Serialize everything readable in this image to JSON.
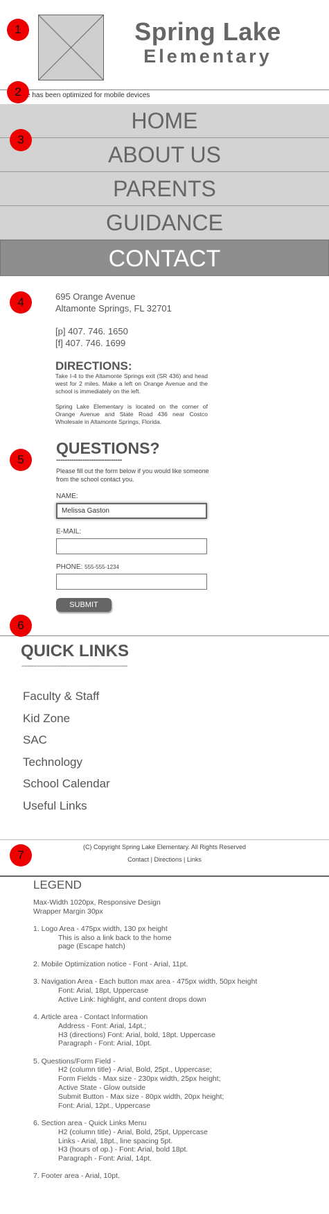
{
  "header": {
    "school_line1": "Spring Lake",
    "school_line2": "Elementary",
    "mobile_notice": "site has been optimized for mobile devices"
  },
  "markers": [
    "1",
    "2",
    "3",
    "4",
    "5",
    "6",
    "7"
  ],
  "nav": {
    "items": [
      {
        "label": "HOME"
      },
      {
        "label": "ABOUT US"
      },
      {
        "label": "PARENTS"
      },
      {
        "label": "GUIDANCE"
      },
      {
        "label": "CONTACT"
      }
    ]
  },
  "contact": {
    "address1": "695 Orange Avenue",
    "address2": "Altamonte Springs, FL 32701",
    "phone": "[p] 407. 746. 1650",
    "fax": "[f] 407. 746. 1699",
    "directions_title": "DIRECTIONS:",
    "directions_p1": "Take I-4 to the Altamonte Springs exit (SR 436) and head west for 2 miles. Make a left on Orange Avenue and the school is immediately on the left.",
    "directions_p2": "Spring Lake Elementary is located on the corner of Orange Avenue and State Road 436 near Costco Wholesale in Altamonte Springs, Florida."
  },
  "questions": {
    "title": "QUESTIONS?",
    "dash": "------------------------------",
    "intro": "Please fill out the form below if you would like someone from the school contact you.",
    "name_label": "NAME:",
    "name_value": "Melissa Gaston",
    "email_label": "E-MAIL:",
    "phone_label": "PHONE:",
    "phone_hint": "555-555-1234",
    "submit_label": "SUBMIT"
  },
  "quick_links": {
    "title": "QUICK LINKS",
    "dash": "------------------------------------------------------",
    "items": [
      "Faculty & Staff",
      "Kid Zone",
      "SAC",
      "Technology",
      "School Calendar",
      "Useful Links"
    ]
  },
  "footer": {
    "copyright": "(C) Copyright Spring Lake Elementary. All Rights Reserved",
    "link_contact": "Contact",
    "link_directions": "Directions",
    "link_links": "Links",
    "separator": "|"
  },
  "legend": {
    "title": "LEGEND",
    "intro1": "Max-Width 1020px, Responsive Design",
    "intro2": "Wrapper Margin 30px",
    "i1_a": "1. Logo Area - 475px width, 130 px height",
    "i1_b": "This is also a link back to the home",
    "i1_c": "page (Escape hatch)",
    "i2_a": "2. Mobile Optimization notice - Font - Arial, 11pt.",
    "i3_a": "3. Navigation Area - Each button max area - 475px width, 50px height",
    "i3_b": "Font: Arial, 18pt, Uppercase",
    "i3_c": "Active Link: highlight, and content drops down",
    "i4_a": "4. Article area - Contact Information",
    "i4_b": "Address - Font: Arial, 14pt.;",
    "i4_c": "H3 (directions) Font: Arial, bold, 18pt. Uppercase",
    "i4_d": "Paragraph - Font: Arial, 10pt.",
    "i5_a": "5. Questions/Form Field -",
    "i5_b": "H2 (column title) - Arial, Bold, 25pt., Uppercase;",
    "i5_c": "Form Fields - Max size - 230px width, 25px height;",
    "i5_d": "Active State - Glow outside",
    "i5_e": "Submit Button - Max size - 80px width, 20px height;",
    "i5_f": "Font: Arial, 12pt., Uppercase",
    "i6_a": "6. Section area - Quick Links Menu",
    "i6_b": "H2 (column title) - Arial, Bold, 25pt, Uppercase",
    "i6_c": "Links - Arial, 18pt., line spacing 5pt.",
    "i6_d": "H3 (hours of op.) - Font: Arial, bold 18pt.",
    "i6_e": "Paragraph - Font: Arial, 14pt.",
    "i7_a": "7. Footer area - Arial, 10pt."
  },
  "colors": {
    "marker": "#ee0000",
    "nav_bg": "#d3d3d3",
    "nav_active_bg": "#8e8e8e",
    "text": "#555555"
  }
}
